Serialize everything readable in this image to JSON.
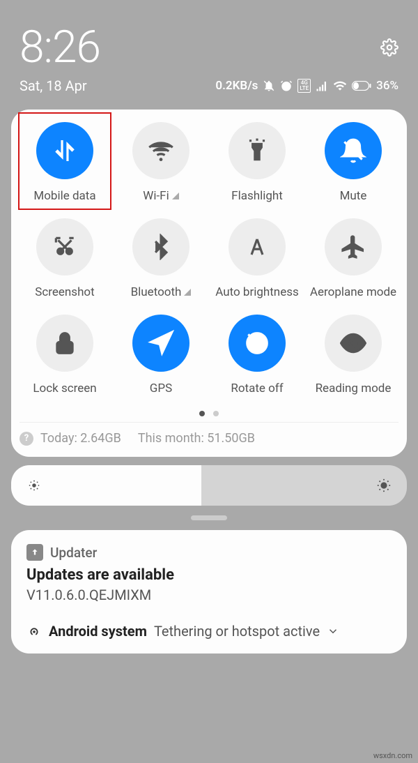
{
  "statusbar": {
    "time": "8:26",
    "date": "Sat, 18 Apr",
    "net_speed": "0.2KB/s",
    "battery_pct": "36%"
  },
  "tiles": [
    {
      "label": "Mobile data",
      "active": true,
      "highlighted": true
    },
    {
      "label": "Wi-Fi",
      "active": false,
      "indicator": true
    },
    {
      "label": "Flashlight",
      "active": false
    },
    {
      "label": "Mute",
      "active": true
    },
    {
      "label": "Screenshot",
      "active": false
    },
    {
      "label": "Bluetooth",
      "active": false,
      "indicator": true
    },
    {
      "label": "Auto brightness",
      "active": false
    },
    {
      "label": "Aeroplane mode",
      "active": false
    },
    {
      "label": "Lock screen",
      "active": false
    },
    {
      "label": "GPS",
      "active": true
    },
    {
      "label": "Rotate off",
      "active": true
    },
    {
      "label": "Reading mode",
      "active": false
    }
  ],
  "usage": {
    "today": "Today: 2.64GB",
    "month": "This month: 51.50GB"
  },
  "notifications": {
    "updater": {
      "app": "Updater",
      "title": "Updates are available",
      "body": "V11.0.6.0.QEJMIXM"
    },
    "system": {
      "app": "Android system",
      "msg": "Tethering or hotspot active"
    }
  },
  "watermark": "wsxdn.com"
}
